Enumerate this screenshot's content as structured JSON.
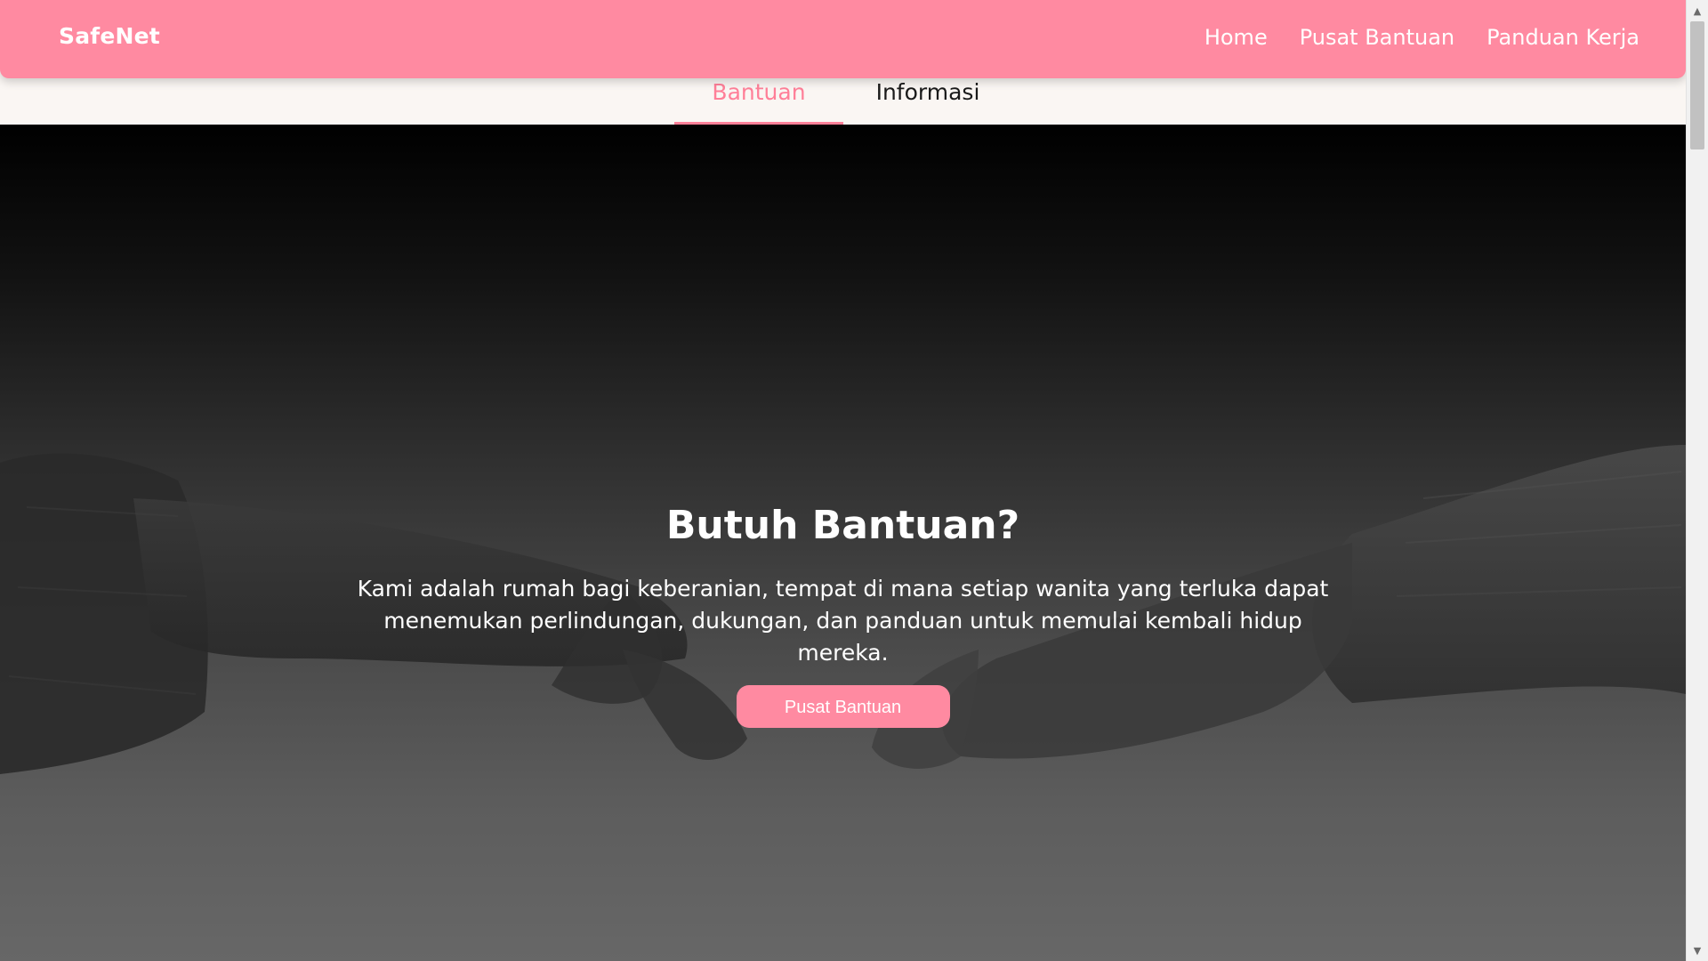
{
  "brand": "SafeNet",
  "nav": {
    "items": [
      "Home",
      "Pusat Bantuan",
      "Panduan Kerja"
    ]
  },
  "tabs": {
    "items": [
      "Bantuan",
      "Informasi"
    ],
    "active": "Bantuan"
  },
  "hero": {
    "title": "Butuh Bantuan?",
    "text": "Kami adalah rumah bagi keberanian, tempat di mana setiap wanita yang terluka dapat menemukan perlindungan, dukungan, dan panduan untuk memulai kembali hidup mereka.",
    "button_label": "Pusat Bantuan",
    "background_image": "two-hands-reaching-grayscale"
  },
  "colors": {
    "accent": "#ff8aa1",
    "tab_active": "#ff7f98",
    "tab_bg": "#faf6f3"
  }
}
